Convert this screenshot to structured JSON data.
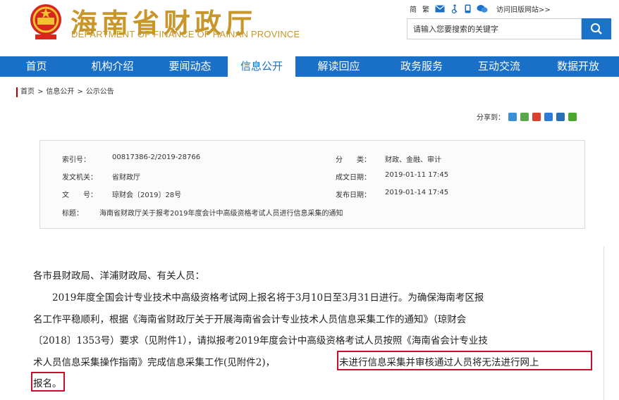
{
  "header": {
    "title_cn": "海南省财政厅",
    "title_en": "DEPARTMENT OF FINANCE OF HAINAN PROVINCE",
    "lang_simplified": "简",
    "lang_traditional": "繁",
    "old_site_link": "访问旧版网站>>",
    "search_placeholder": "请输入您要搜索的关键字"
  },
  "nav": {
    "items": [
      "首页",
      "机构介绍",
      "要闻动态",
      "信息公开",
      "解读回应",
      "政务服务",
      "互动交流",
      "数据开放"
    ],
    "active": "信息公开"
  },
  "breadcrumb": {
    "home": "首页",
    "section": "信息公开",
    "current": "公示公告",
    "separator": ">"
  },
  "share": {
    "label": "分享到："
  },
  "meta": {
    "index_label": "索引号：",
    "index_value": "00817386-2/2019-28766",
    "category_label": "分　　类：",
    "category_value": "财政、金融、审计",
    "issuer_label": "发文机关：",
    "issuer_value": "省财政厅",
    "created_label": "成文日期：",
    "created_value": "2019-01-11 17:45",
    "docno_label": "文　　号：",
    "docno_value": "琼财会〔2019〕28号",
    "published_label": "发布日期：",
    "published_value": "2019-01-14 17:45",
    "subject_label": "标题：",
    "subject_value": "海南省财政厅关于报考2019年度会计中高级资格考试人员进行信息采集的通知"
  },
  "body": {
    "salutation": "各市县财政局、洋浦财政局、有关人员：",
    "line1": "2019年度全国会计专业技术中高级资格考试网上报名将于3月10日至3月31日进行。为确保海南考区报",
    "line2": "名工作平稳顺利，根据《海南省财政厅关于开展海南省会计专业技术人员信息采集工作的通知》（琼财会",
    "line3": "〔2018〕1353号）要求（见附件1），请拟报考2019年度会计中高级资格考试人员按照《海南省会计专业技",
    "line4_a": "术人员信息采集操作指南》完成信息采集工作(见附件2)，",
    "line4_b": "未进行信息采集并审核通过人员将无法进行网上",
    "line5": "报名。"
  },
  "colors": {
    "nav_blue": "#1a6fc6",
    "title_gold": "#c8962a",
    "highlight_red": "#c8102e"
  }
}
